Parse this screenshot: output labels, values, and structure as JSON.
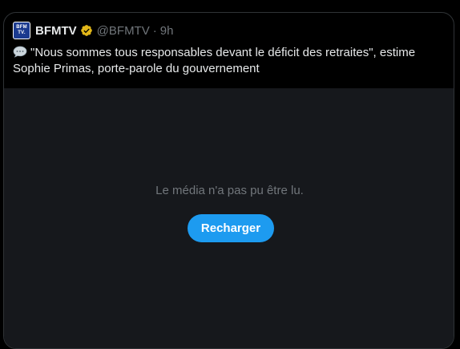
{
  "tweet": {
    "avatar_lines": [
      "BFM",
      "TV."
    ],
    "display_name": "BFMTV",
    "handle": "@BFMTV",
    "separator": "·",
    "time": "9h",
    "verified_icon": "gold-verified-badge",
    "emoji_icon": "speech-balloon",
    "text": "\"Nous sommes tous responsables devant le déficit des retraites\", estime Sophie Primas, porte-parole du gouvernement"
  },
  "media": {
    "error_message": "Le média n'a pas pu être lu.",
    "reload_label": "Recharger"
  },
  "colors": {
    "accent": "#1d9bf0",
    "verified": "#e2b719",
    "media_bg": "#16181c"
  }
}
